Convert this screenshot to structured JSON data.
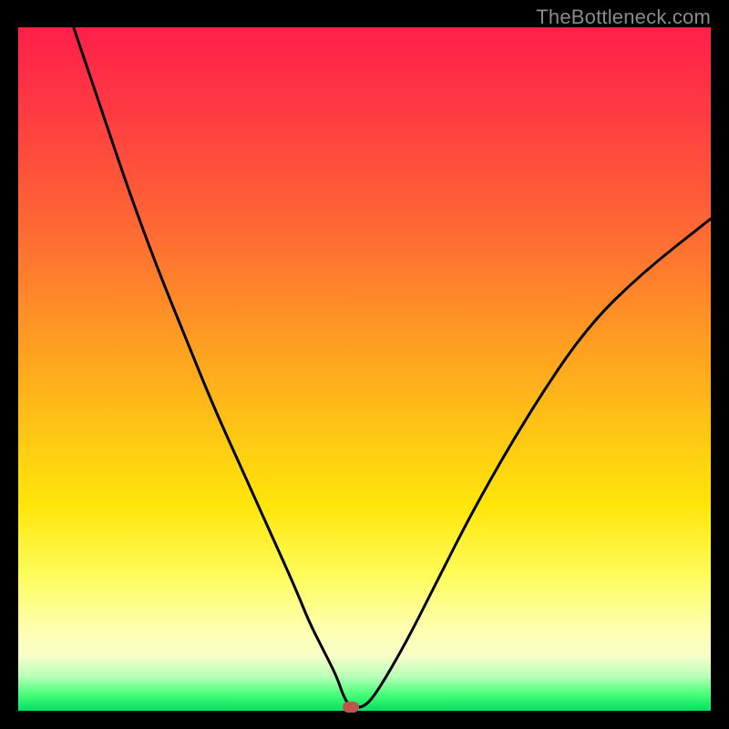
{
  "watermark": "TheBottleneck.com",
  "colors": {
    "gradient_top": "#ff1f4a",
    "gradient_mid1": "#ff9a23",
    "gradient_mid2": "#ffe60a",
    "gradient_bottom": "#00e060",
    "curve": "#000000",
    "marker": "#c0534b",
    "frame": "#000000"
  },
  "chart_data": {
    "type": "line",
    "title": "",
    "xlabel": "",
    "ylabel": "",
    "xlim": [
      0,
      100
    ],
    "ylim": [
      0,
      100
    ],
    "grid": false,
    "legend": false,
    "annotations": [],
    "series": [
      {
        "name": "bottleneck-curve",
        "x": [
          8,
          12,
          16,
          20,
          24,
          28,
          32,
          36,
          40,
          42,
          44,
          46,
          47,
          48,
          50,
          52,
          56,
          60,
          66,
          74,
          82,
          90,
          100
        ],
        "y": [
          100,
          88,
          76,
          65,
          55,
          45,
          36,
          27,
          18,
          13,
          9,
          5,
          2,
          0.5,
          0.5,
          3,
          10,
          18,
          30,
          44,
          56,
          64,
          72
        ]
      }
    ],
    "marker": {
      "x": 48,
      "y": 0.5
    }
  }
}
